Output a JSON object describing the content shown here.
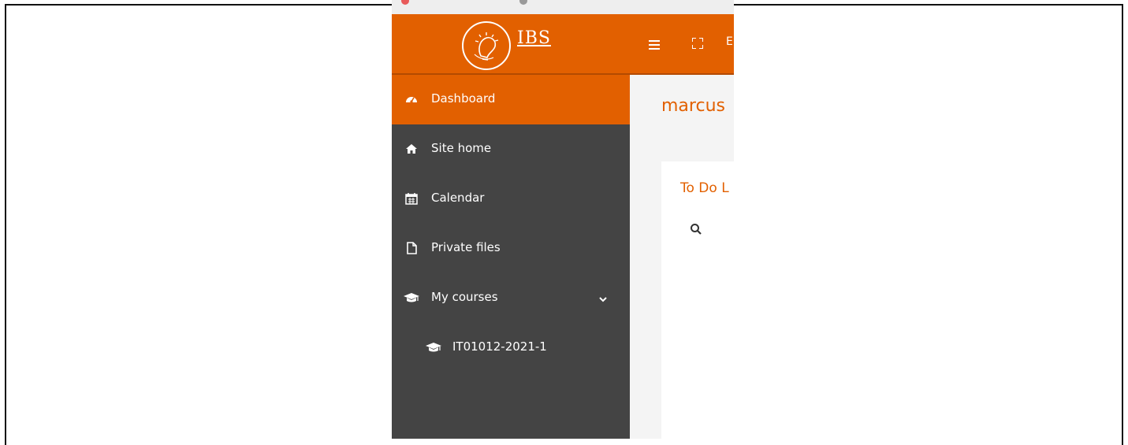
{
  "brand": {
    "logo_text": "IBS",
    "accent_color": "#e26000",
    "sidebar_color": "#444444"
  },
  "topbar": {
    "menu_icon": "hamburger-icon",
    "fullscreen_icon": "fullscreen-icon",
    "partial_text": "E"
  },
  "sidebar": {
    "items": [
      {
        "label": "Dashboard",
        "icon": "dashboard-icon",
        "active": true
      },
      {
        "label": "Site home",
        "icon": "home-icon"
      },
      {
        "label": "Calendar",
        "icon": "calendar-icon"
      },
      {
        "label": "Private files",
        "icon": "file-icon"
      },
      {
        "label": "My courses",
        "icon": "graduation-cap-icon",
        "expandable": true,
        "chevron_icon": "chevron-down-icon"
      },
      {
        "label": "IT01012-2021-1",
        "icon": "graduation-cap-icon",
        "sub": true
      }
    ]
  },
  "main": {
    "user_heading": "marcus",
    "todo_card": {
      "title": "To Do L",
      "search_icon": "search-icon"
    }
  }
}
